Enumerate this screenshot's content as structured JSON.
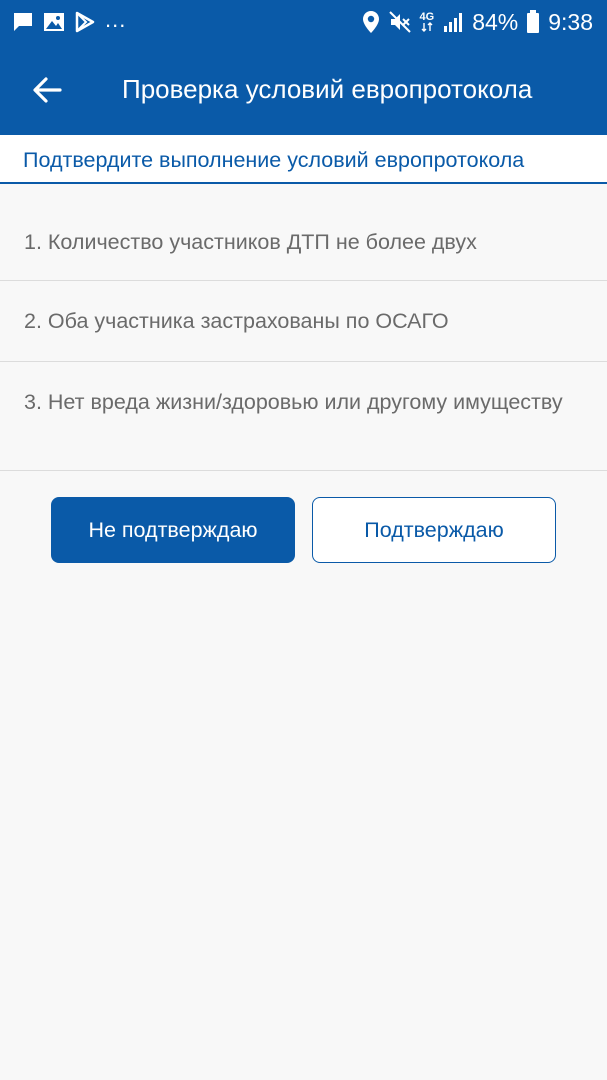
{
  "status_bar": {
    "left_icons": [
      "message-icon",
      "image-icon",
      "play-store-icon"
    ],
    "more_indicator": "...",
    "right_icons": [
      "location-icon",
      "mute-icon",
      "network-4g-icon",
      "signal-icon",
      "battery-icon"
    ],
    "network_label": "4G",
    "battery_percent": "84%",
    "time": "9:38"
  },
  "app_bar": {
    "back_icon": "arrow-left-icon",
    "title": "Проверка условий европротокола"
  },
  "subheader": {
    "text": "Подтвердите выполнение условий европротокола"
  },
  "conditions": [
    {
      "text": "1. Количество участников ДТП не более двух"
    },
    {
      "text": "2. Оба участника застрахованы по ОСАГО"
    },
    {
      "text": "3. Нет вреда жизни/здоровью или другому имуществу"
    }
  ],
  "buttons": {
    "decline_label": "Не подтверждаю",
    "confirm_label": "Подтверждаю"
  },
  "colors": {
    "primary": "#0a5aa8",
    "background": "#f8f8f8",
    "text_muted": "#6a6a6a",
    "divider": "#dcdcdc"
  }
}
